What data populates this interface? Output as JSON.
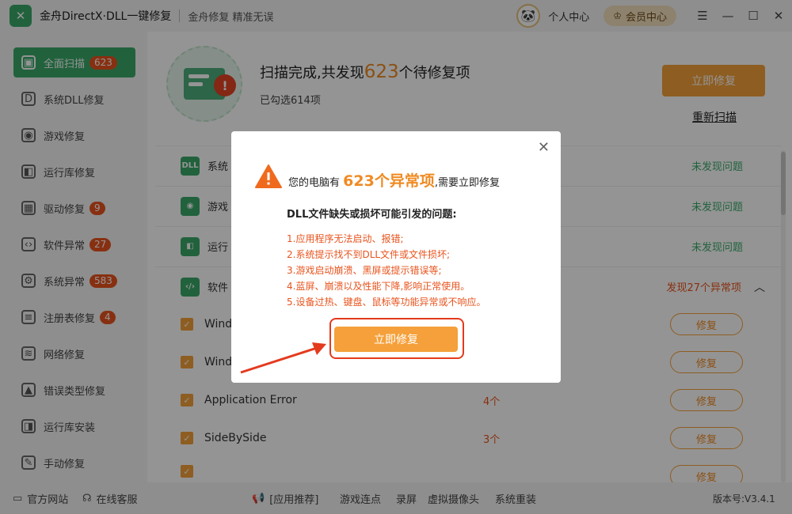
{
  "titlebar": {
    "logo_glyph": "✕",
    "title": "金舟DirectX·DLL一键修复",
    "slogan": "金舟修复 精准无误",
    "personal": "个人中心",
    "vip": "会员中心",
    "controls": [
      "☰",
      "—",
      "☐",
      "✕"
    ]
  },
  "sidebar": {
    "items": [
      {
        "label": "全面扫描",
        "badge": "623",
        "icon": "▣"
      },
      {
        "label": "系统DLL修复",
        "badge": "",
        "icon": "D"
      },
      {
        "label": "游戏修复",
        "badge": "",
        "icon": "◉"
      },
      {
        "label": "运行库修复",
        "badge": "",
        "icon": "◧"
      },
      {
        "label": "驱动修复",
        "badge": "9",
        "icon": "▦"
      },
      {
        "label": "软件异常",
        "badge": "27",
        "icon": "‹›"
      },
      {
        "label": "系统异常",
        "badge": "583",
        "icon": "⚙"
      },
      {
        "label": "注册表修复",
        "badge": "4",
        "icon": "≡"
      },
      {
        "label": "网络修复",
        "badge": "",
        "icon": "≋"
      },
      {
        "label": "错误类型修复",
        "badge": "",
        "icon": "▲"
      },
      {
        "label": "运行库安装",
        "badge": "",
        "icon": "◨"
      },
      {
        "label": "手动修复",
        "badge": "",
        "icon": "✎"
      }
    ]
  },
  "scan": {
    "title_prefix": "扫描完成,共发现",
    "count": "623",
    "title_suffix": "个待修复项",
    "selected": "已勾选614项",
    "repair_now": "立即修复",
    "rescan": "重新扫描"
  },
  "categories": [
    {
      "name": "系统",
      "status": "未发现问题",
      "icon": "DLL"
    },
    {
      "name": "游戏",
      "status": "未发现问题",
      "icon": "◉"
    },
    {
      "name": "运行",
      "status": "未发现问题",
      "icon": "◧"
    },
    {
      "name": "软件",
      "status": "发现27个异常项",
      "icon": "‹/›"
    }
  ],
  "items": [
    {
      "name": "Wind",
      "count": "",
      "fix": "修复"
    },
    {
      "name": "Wind",
      "count": "",
      "fix": "修复"
    },
    {
      "name": "Application Error",
      "count": "4个",
      "fix": "修复"
    },
    {
      "name": "SideBySide",
      "count": "3个",
      "fix": "修复"
    },
    {
      "name": "",
      "count": "",
      "fix": "修复"
    }
  ],
  "footer": {
    "official": "官方网站",
    "support": "在线客服",
    "recommend": "[应用推荐]",
    "links": [
      "游戏连点",
      "录屏",
      "虚拟摄像头",
      "系统重装"
    ],
    "version": "版本号:V3.4.1"
  },
  "modal": {
    "close": "✕",
    "head_prefix": "您的电脑有",
    "head_big": "623个异常项",
    "head_suffix": ",需要立即修复",
    "subtitle": "DLL文件缺失或损坏可能引发的问题:",
    "problems": [
      "1.应用程序无法启动、报错;",
      "2.系统提示找不到DLL文件或文件损坏;",
      "3.游戏启动崩溃、黑屏或提示错误等;",
      "4.蓝屏、崩溃以及性能下降,影响正常使用。",
      "5.设备过热、键盘、鼠标等功能异常或不响应。"
    ],
    "button": "立即修复"
  },
  "colors": {
    "brand_green": "#3aaa6a",
    "accent_orange": "#f5a03a",
    "warn_red": "#e8541e"
  }
}
